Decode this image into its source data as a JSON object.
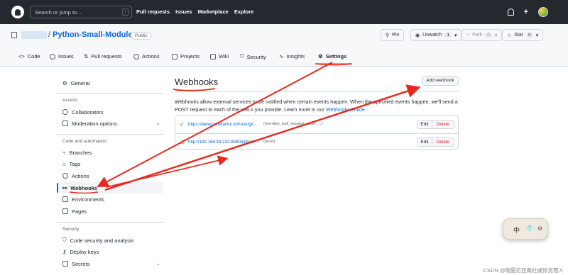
{
  "topbar": {
    "search_placeholder": "Search or jump to...",
    "search_shortcut": "/",
    "nav": [
      "Pull requests",
      "Issues",
      "Marketplace",
      "Explore"
    ]
  },
  "repo": {
    "separator": "/",
    "name": "Python-Small-Module",
    "visibility": "Public",
    "pin_label": "Pin",
    "unwatch_label": "Unwatch",
    "unwatch_count": "1",
    "fork_label": "Fork",
    "fork_count": "0",
    "star_label": "Star",
    "star_count": "0"
  },
  "tabs": [
    "Code",
    "Issues",
    "Pull requests",
    "Actions",
    "Projects",
    "Wiki",
    "Security",
    "Insights",
    "Settings"
  ],
  "sidebar": {
    "general": "General",
    "access_heading": "Access",
    "collaborators": "Collaborators",
    "moderation": "Moderation options",
    "code_heading": "Code and automation",
    "branches": "Branches",
    "tags": "Tags",
    "actions": "Actions",
    "webhooks": "Webhooks",
    "environments": "Environments",
    "pages": "Pages",
    "security_heading": "Security",
    "code_security": "Code security and analysis",
    "deploy_keys": "Deploy keys",
    "secrets": "Secrets"
  },
  "main": {
    "title": "Webhooks",
    "add_button": "Add webhook",
    "desc_part1": "Webhooks allow external services to be notified when certain events happen. When the specified events happen, we'll send a POST request to each of the URLs you provide. Learn more in our ",
    "desc_link": "Webhooks Guide",
    "desc_end": ".",
    "hooks": [
      {
        "status": "✓",
        "url": "https://www.codefactor.io/hook/git...",
        "events": "(member, pull_request, push, ...)",
        "edit": "Edit",
        "delete": "Delete"
      },
      {
        "status": "⚠",
        "url": "http://192.168.43.232:8080/github-...",
        "events": "(push)",
        "edit": "Edit",
        "delete": "Delete"
      }
    ]
  },
  "widget": {
    "zh": "中"
  },
  "watermark": "CSDN @瑞曼尼亚桑杜威修克理人",
  "colors": {
    "topbar": "#24292f",
    "link": "#0969da",
    "danger": "#cf222e",
    "tab_underline": "#fd8c73",
    "annotation": "#e8281e"
  }
}
